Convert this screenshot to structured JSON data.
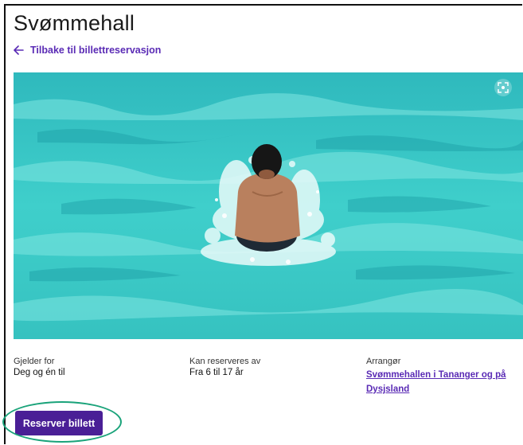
{
  "page": {
    "title": "Svømmehall",
    "back_link": "Tilbake til billettreservasjon"
  },
  "hero": {
    "alt": "Gutt som hopper i svømmebasseng",
    "expand_icon": "expand-icon"
  },
  "info": {
    "applies_to": {
      "label": "Gjelder for",
      "value": "Deg og én til"
    },
    "reservable_by": {
      "label": "Kan reserveres av",
      "value": "Fra 6 til 17 år"
    },
    "organizer": {
      "label": "Arrangør",
      "line1": "Svømmehallen i Tananger og på",
      "line2": "Dysjsland"
    }
  },
  "actions": {
    "reserve_label": "Reserver billett"
  },
  "colors": {
    "accent": "#5a2bb5",
    "button": "#4a1f96",
    "water": "#3cc8c7",
    "highlight": "#1aa37a"
  }
}
